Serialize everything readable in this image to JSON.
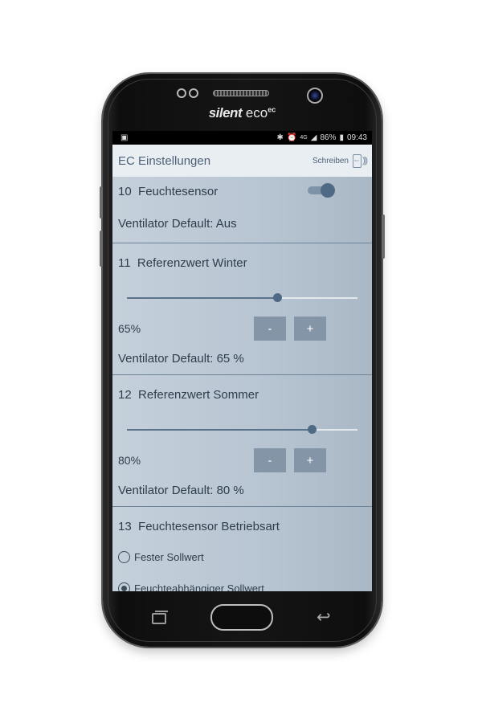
{
  "device": {
    "brand_bold": "silent",
    "brand_light": "eco",
    "brand_sup": "ec"
  },
  "status_bar": {
    "network": "4G",
    "battery": "86%",
    "time": "09:43"
  },
  "app_bar": {
    "title": "EC Einstellungen",
    "write_label": "Schreiben",
    "nfc_label": "NFC"
  },
  "sections": {
    "s10": {
      "number": "10",
      "title": "Feuchtesensor",
      "toggle_on": true,
      "default_text": "Ventilator Default: Aus"
    },
    "s11": {
      "number": "11",
      "title": "Referenzwert Winter",
      "slider_percent": 65,
      "value_text": "65%",
      "minus_label": "-",
      "plus_label": "+",
      "default_text": "Ventilator Default: 65 %"
    },
    "s12": {
      "number": "12",
      "title": "Referenzwert Sommer",
      "slider_percent": 80,
      "value_text": "80%",
      "minus_label": "-",
      "plus_label": "+",
      "default_text": "Ventilator Default: 80 %"
    },
    "s13": {
      "number": "13",
      "title": "Feuchtesensor Betriebsart",
      "options": [
        {
          "label": "Fester Sollwert",
          "selected": false
        },
        {
          "label": "Feuchteabhängiger Sollwert",
          "selected": true
        }
      ]
    }
  },
  "colors": {
    "accent": "#4f6a85",
    "button": "#8495a8",
    "background": "#b9c6d3"
  }
}
